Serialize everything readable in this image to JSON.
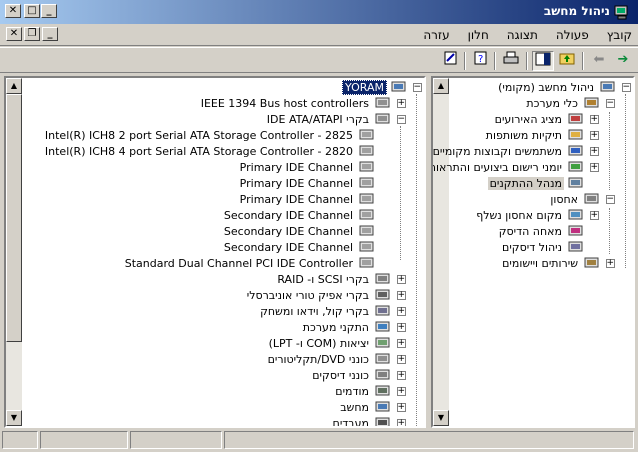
{
  "window": {
    "title": "ניהול מחשב"
  },
  "menu": [
    "קובץ",
    "פעולה",
    "תצוגה",
    "חלון",
    "עזרה"
  ],
  "right_tree": [
    {
      "label": "ניהול מחשב (מקומי)",
      "icon": "computer-management-icon",
      "level": 0,
      "exp": "−"
    },
    {
      "label": "כלי מערכת",
      "icon": "tools-icon",
      "level": 1,
      "exp": "−"
    },
    {
      "label": "מציג האירועים",
      "icon": "event-viewer-icon",
      "level": 2,
      "exp": "+"
    },
    {
      "label": "תיקיות משותפות",
      "icon": "shared-folder-icon",
      "level": 2,
      "exp": "+"
    },
    {
      "label": "משתמשים וקבוצות מקומיים",
      "icon": "users-icon",
      "level": 2,
      "exp": "+"
    },
    {
      "label": "יומני רישום ביצועים והתראות",
      "icon": "performance-icon",
      "level": 2,
      "exp": "+"
    },
    {
      "label": "מנהל ההתקנים",
      "icon": "device-manager-icon",
      "level": 2,
      "exp": "",
      "highlight": true
    },
    {
      "label": "אחסון",
      "icon": "storage-icon",
      "level": 1,
      "exp": "−"
    },
    {
      "label": "מקום אחסון נשלף",
      "icon": "removable-storage-icon",
      "level": 2,
      "exp": "+"
    },
    {
      "label": "מאחה הדיסק",
      "icon": "defrag-icon",
      "level": 2,
      "exp": ""
    },
    {
      "label": "ניהול דיסקים",
      "icon": "disk-management-icon",
      "level": 2,
      "exp": ""
    },
    {
      "label": "שירותים ויישומים",
      "icon": "services-icon",
      "level": 1,
      "exp": "+"
    }
  ],
  "left_tree": [
    {
      "label": "YORAM",
      "icon": "computer-icon",
      "level": 0,
      "exp": "−",
      "selected": true
    },
    {
      "label": "IEEE 1394 Bus host controllers",
      "icon": "bus-controller-icon",
      "level": 1,
      "exp": "+",
      "ltr": true
    },
    {
      "label": "בקרי IDE ATA/ATAPI",
      "icon": "ide-controller-icon",
      "level": 1,
      "exp": "−"
    },
    {
      "label": "Intel(R) ICH8 2 port Serial ATA Storage Controller - 2825",
      "icon": "ide-device-icon",
      "level": 2,
      "exp": "",
      "ltr": true
    },
    {
      "label": "Intel(R) ICH8 4 port Serial ATA Storage Controller - 2820",
      "icon": "ide-device-icon",
      "level": 2,
      "exp": "",
      "ltr": true
    },
    {
      "label": "Primary IDE Channel",
      "icon": "ide-device-icon",
      "level": 2,
      "exp": "",
      "ltr": true
    },
    {
      "label": "Primary IDE Channel",
      "icon": "ide-device-icon",
      "level": 2,
      "exp": "",
      "ltr": true
    },
    {
      "label": "Primary IDE Channel",
      "icon": "ide-device-icon",
      "level": 2,
      "exp": "",
      "ltr": true
    },
    {
      "label": "Secondary IDE Channel",
      "icon": "ide-device-icon",
      "level": 2,
      "exp": "",
      "ltr": true
    },
    {
      "label": "Secondary IDE Channel",
      "icon": "ide-device-icon",
      "level": 2,
      "exp": "",
      "ltr": true
    },
    {
      "label": "Secondary IDE Channel",
      "icon": "ide-device-icon",
      "level": 2,
      "exp": "",
      "ltr": true
    },
    {
      "label": "Standard Dual Channel PCI IDE Controller",
      "icon": "ide-device-icon",
      "level": 2,
      "exp": "",
      "ltr": true
    },
    {
      "label": "בקרי SCSI ו- RAID",
      "icon": "scsi-icon",
      "level": 1,
      "exp": "+"
    },
    {
      "label": "בקרי אפיק טורי אוניברסלי",
      "icon": "usb-icon",
      "level": 1,
      "exp": "+"
    },
    {
      "label": "בקרי קול, וידאו ומשחק",
      "icon": "sound-icon",
      "level": 1,
      "exp": "+"
    },
    {
      "label": "התקני מערכת",
      "icon": "system-device-icon",
      "level": 1,
      "exp": "+"
    },
    {
      "label": "יציאות (COM ו- LPT)",
      "icon": "port-icon",
      "level": 1,
      "exp": "+"
    },
    {
      "label": "כונני DVD/תקליטורים",
      "icon": "dvd-icon",
      "level": 1,
      "exp": "+"
    },
    {
      "label": "כונני דיסקים",
      "icon": "disk-drive-icon",
      "level": 1,
      "exp": "+"
    },
    {
      "label": "מודמים",
      "icon": "modem-icon",
      "level": 1,
      "exp": "+"
    },
    {
      "label": "מחשב",
      "icon": "computer-small-icon",
      "level": 1,
      "exp": "+"
    },
    {
      "label": "מעבדים",
      "icon": "processor-icon",
      "level": 1,
      "exp": "+"
    }
  ]
}
